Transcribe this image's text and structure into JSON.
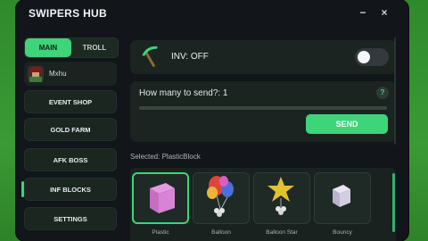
{
  "window": {
    "title": "SWIPERS HUB",
    "minimize_glyph": "−",
    "close_glyph": "×"
  },
  "tabs": [
    {
      "label": "MAIN",
      "active": true
    },
    {
      "label": "TROLL",
      "active": false
    }
  ],
  "profile": {
    "name": "Mxhu"
  },
  "sidebar": {
    "items": [
      {
        "label": "EVENT SHOP"
      },
      {
        "label": "GOLD FARM"
      },
      {
        "label": "AFK BOSS"
      },
      {
        "label": "INF BLOCKS",
        "active": true
      },
      {
        "label": "SETTINGS"
      }
    ]
  },
  "inventory": {
    "label": "INV: OFF",
    "enabled": false,
    "icon": "pickaxe-icon"
  },
  "send": {
    "label": "How many to send?: 1",
    "help_glyph": "?",
    "button_label": "SEND"
  },
  "selected": {
    "label": "Selected: PlasticBlock"
  },
  "blocks": [
    {
      "name": "Plastic",
      "icon": "plastic-block-icon",
      "selected": true
    },
    {
      "name": "Balloon",
      "icon": "balloon-block-icon",
      "selected": false
    },
    {
      "name": "Balloon Star",
      "icon": "balloon-star-block-icon",
      "selected": false
    },
    {
      "name": "Bouncy",
      "icon": "bouncy-block-icon",
      "selected": false
    }
  ],
  "colors": {
    "accent": "#3ed47a",
    "panel": "#1b2420",
    "window": "#12151a"
  }
}
